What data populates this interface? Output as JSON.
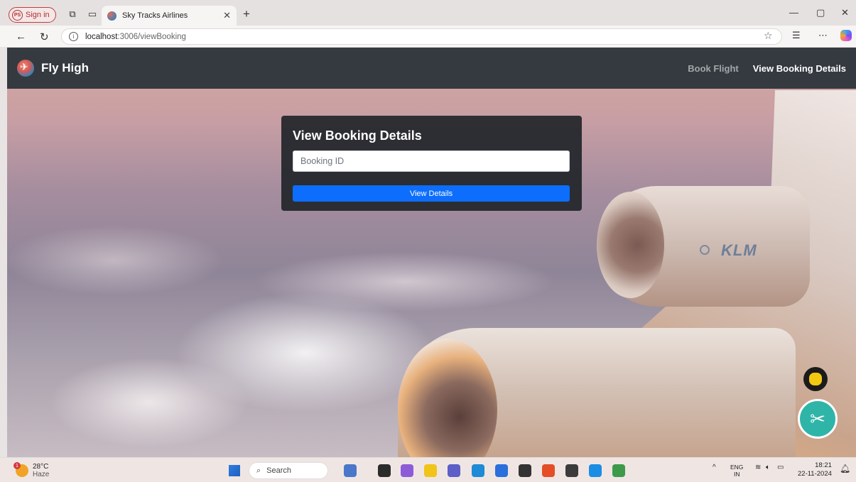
{
  "browser": {
    "profile_initials": "PS",
    "profile_label": "Sign in",
    "tab_title": "Sky Tracks Airlines",
    "url_host": "localhost",
    "url_path": ":3006/viewBooking"
  },
  "app": {
    "brand": "Fly High",
    "nav": [
      {
        "label": "Book Flight",
        "active": false
      },
      {
        "label": "View Booking Details",
        "active": true
      }
    ],
    "card": {
      "title": "View Booking Details",
      "input_placeholder": "Booking ID",
      "input_value": "",
      "button_label": "View Details"
    },
    "engine_brand": "KLM",
    "accent_color": "#0d6efd",
    "navbar_color": "#343a40"
  },
  "taskbar": {
    "weather_temp": "28°C",
    "weather_cond": "Haze",
    "weather_badge": "1",
    "search_label": "Search",
    "lang_top": "ENG",
    "lang_bottom": "IN",
    "time": "18:21",
    "date": "22-11-2024"
  }
}
